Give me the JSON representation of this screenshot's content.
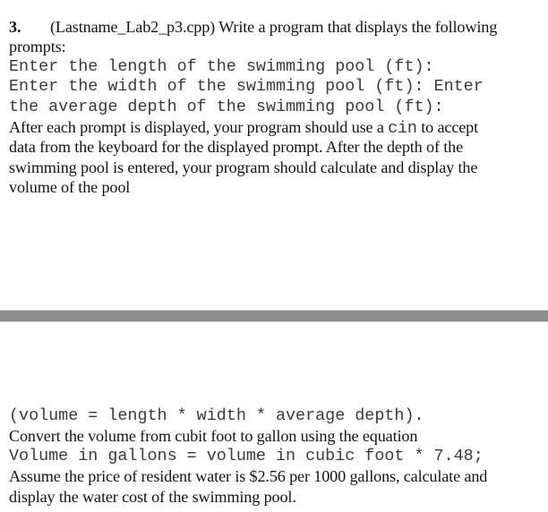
{
  "question": {
    "number": "3.",
    "title": "(Lastname_Lab2_p3.cpp) Write a program that displays the following",
    "title_cont": "prompts:",
    "prompts": [
      "Enter the length of the swimming pool (ft):",
      "Enter the width of the swimming pool (ft): Enter",
      "the average depth of the swimming pool (ft):"
    ],
    "paragraph1": {
      "line1_before": "After each prompt is displayed, your program should use a ",
      "line1_code": "cin",
      "line1_after": " to accept",
      "line2": "data from the keyboard for the displayed prompt. After the depth of the",
      "line3": "swimming pool is entered, your program should calculate and display the",
      "line4": "volume of the pool"
    }
  },
  "continuation": {
    "volume_formula": "(volume = length * width * average depth).",
    "convert_text": "Convert the volume from cubit foot to gallon using the equation",
    "gallon_formula": "Volume in gallons = volume in cubic foot * 7.48;",
    "price_line1": "Assume the price of resident water is $2.56 per 1000 gallons, calculate and",
    "price_line2": "display the water cost of the swimming pool."
  },
  "colors": {
    "divider": "#8e8e8e",
    "text": "#141414",
    "code_text": "#3a3a3a"
  }
}
